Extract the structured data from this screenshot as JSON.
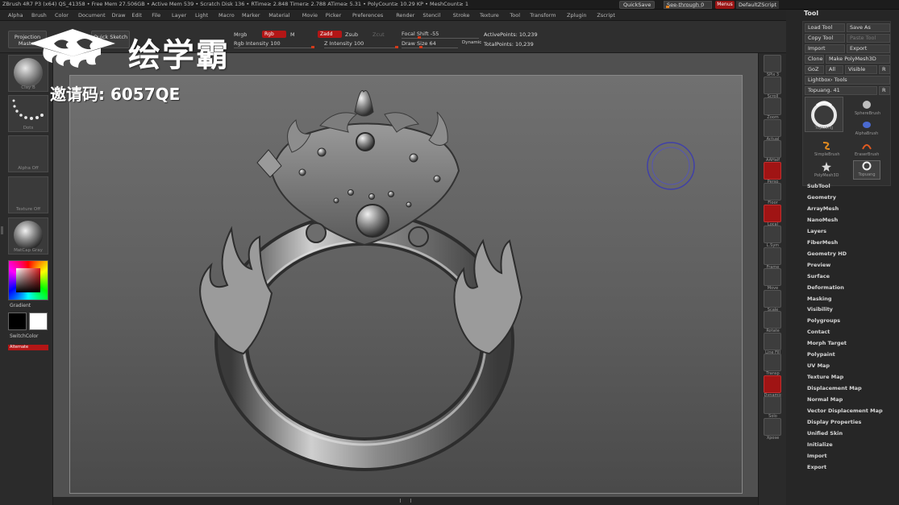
{
  "title": "ZBrush 4R7 P3 (x64)    QS_41358    • Free Mem 27.506GB • Active Mem 539 • Scratch Disk 136 • RTime≥ 2.848 Timer≥ 2.788 ATime≥ 5.31 • PolyCount≥ 10.29 KP • MeshCount≥ 1",
  "quicksave": "QuickSave",
  "seethrough": "See-through  0",
  "menus_label": "Menus",
  "default_script": "DefaultZScript",
  "menu_items": [
    "Alpha",
    "Brush",
    "Color",
    "Document",
    "Draw",
    "Edit",
    "File",
    "Layer",
    "Light",
    "Macro",
    "Marker",
    "Material",
    "Movie",
    "Picker",
    "Preferences",
    "Render",
    "Stencil",
    "Stroke",
    "Texture",
    "Tool",
    "Transform",
    "Zplugin",
    "Zscript"
  ],
  "topshelf": {
    "projection_master": "Projection Master",
    "quick_sketch": "Quick Sketch",
    "mrgb": "Mrgb",
    "rgb": "Rgb",
    "m": "M",
    "zadd": "Zadd",
    "zsub": "Zsub",
    "zcut": "Zcut",
    "rgb_intensity": "Rgb Intensity 100",
    "z_intensity": "Z Intensity 100",
    "focal_shift": "Focal Shift -55",
    "draw_size": "Draw Size 64",
    "dynamic": "Dynamic",
    "active_points": "ActivePoints: 10,239",
    "total_points": "TotalPoints: 10,239"
  },
  "watermark": {
    "brand": "绘学霸",
    "invite": "邀请码: 6057QE"
  },
  "leftshelf": {
    "thumbs": [
      "Clay B",
      "Dots",
      "Alpha Off",
      "Texture Off",
      "MatCap Gray"
    ],
    "gradient": "Gradient",
    "switch_color": "SwitchColor",
    "alternate": "Alternate"
  },
  "righttools": [
    {
      "label": "SPix 3",
      "red": false
    },
    {
      "label": "Scroll",
      "red": false
    },
    {
      "label": "Zoom",
      "red": false
    },
    {
      "label": "Actual",
      "red": false
    },
    {
      "label": "AAHalf",
      "red": false
    },
    {
      "label": "Persp",
      "red": true
    },
    {
      "label": "Floor",
      "red": false
    },
    {
      "label": "Local",
      "red": true
    },
    {
      "label": "L.Sym",
      "red": false
    },
    {
      "label": "Frame",
      "red": false
    },
    {
      "label": "Move",
      "red": false
    },
    {
      "label": "Scale",
      "red": false
    },
    {
      "label": "Rotate",
      "red": false
    },
    {
      "label": "Line Fill",
      "red": false
    },
    {
      "label": "Transp",
      "red": false
    },
    {
      "label": "Dynamic",
      "red": true
    },
    {
      "label": "Solo",
      "red": false
    },
    {
      "label": "Xpose",
      "red": false
    }
  ],
  "tool": {
    "title": "Tool",
    "load_tool": "Load Tool",
    "save_as": "Save As",
    "copy_tool": "Copy Tool",
    "paste_tool": "Paste Tool",
    "import": "Import",
    "export": "Export",
    "clone": "Clone",
    "make_polymesh": "Make PolyMesh3D",
    "goz": "GoZ",
    "all": "All",
    "visible": "Visible",
    "r": "R",
    "lightbox_tools": "Lightbox› Tools",
    "current_tool": "Topuang. 41",
    "brushes": [
      "SphereBrush",
      "AlphaBrush",
      "SimpleBrush",
      "EraserBrush",
      "PolyMesh3D",
      "Topuang"
    ],
    "current_thumb_label": "Topuang",
    "sections": [
      "SubTool",
      "Geometry",
      "ArrayMesh",
      "NanoMesh",
      "Layers",
      "FiberMesh",
      "Geometry HD",
      "Preview",
      "Surface",
      "Deformation",
      "Masking",
      "Visibility",
      "Polygroups",
      "Contact",
      "Morph Target",
      "Polypaint",
      "UV Map",
      "Texture Map",
      "Displacement Map",
      "Normal Map",
      "Vector Displacement Map",
      "Display Properties",
      "Unified Skin",
      "Initialize",
      "Import",
      "Export"
    ]
  },
  "colors": {
    "accent_red": "#b31616",
    "slider_orange": "#e08020",
    "canvas_top": "#707070",
    "canvas_bottom": "#4a4a4a"
  }
}
